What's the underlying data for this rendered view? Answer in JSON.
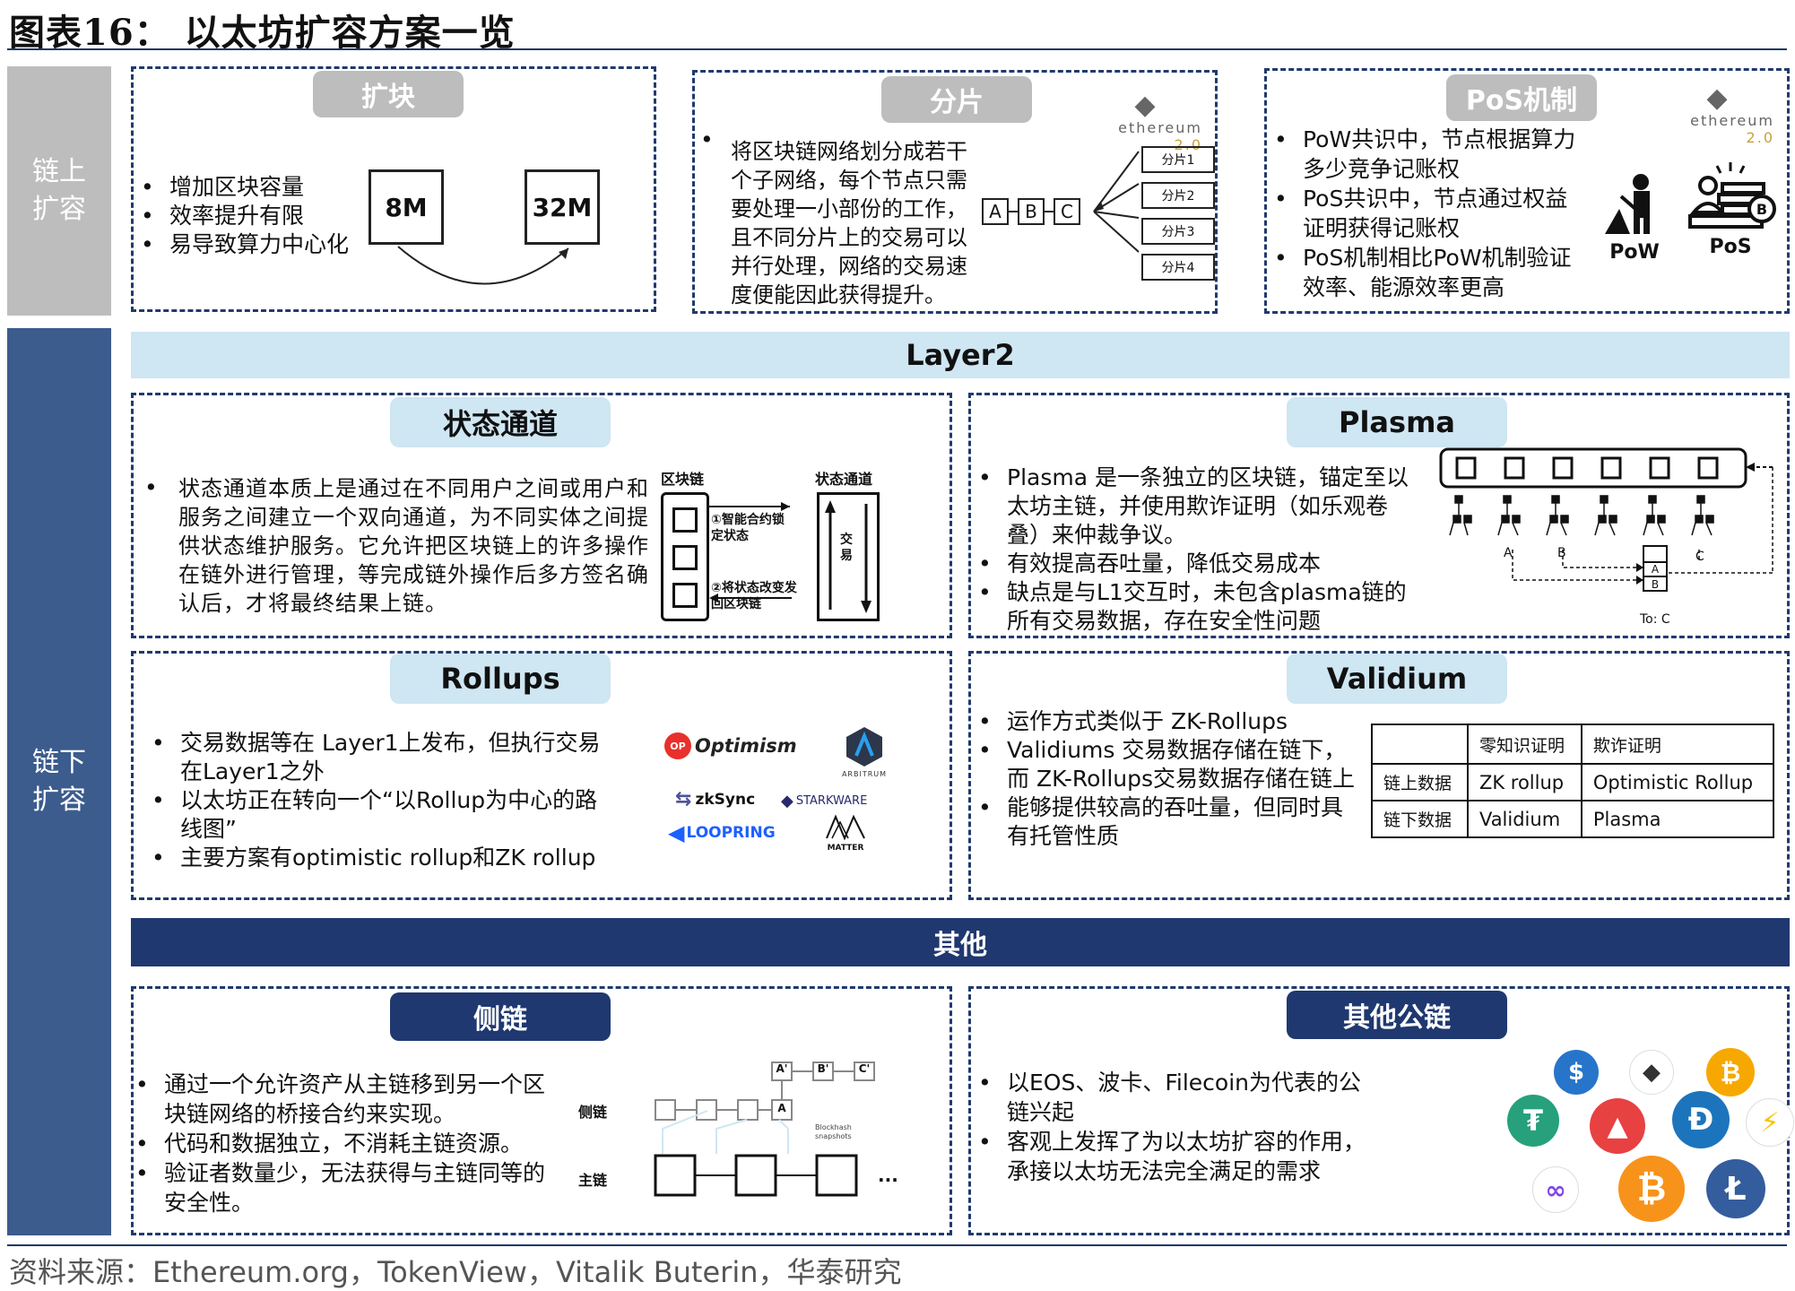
{
  "header": {
    "title": "图表16：  以太坊扩容方案一览"
  },
  "footer": {
    "source": "资料来源：Ethereum.org，TokenView，Vitalik Buterin，华泰研究"
  },
  "sides": {
    "onchain": "链上\n扩容",
    "offchain": "链下\n扩容"
  },
  "bars": {
    "layer2": "Layer2",
    "others": "其他"
  },
  "expand": {
    "title": "扩块",
    "bullets": [
      "增加区块容量",
      "效率提升有限",
      "易导致算力中心化"
    ],
    "box_a": "8M",
    "box_b": "32M"
  },
  "shard": {
    "title": "分片",
    "text_lines": [
      "将区块链网络划分成若干",
      "个子网络，每个节点只需",
      "要处理一小部份的工作，",
      "且不同分片上的交易可以",
      "并行处理，网络的交易速",
      "度便能因此获得提升。"
    ],
    "chain": [
      "A",
      "B",
      "C"
    ],
    "shards": [
      "分片1",
      "分片2",
      "分片3",
      "分片4"
    ],
    "eth_logo": "ethereum",
    "eth_ver": "2.0"
  },
  "pos": {
    "title": "PoS机制",
    "bullets": [
      "PoW共识中，节点根据算力多少竞争记账权",
      "PoS共识中，节点通过权益证明获得记账权",
      "PoS机制相比PoW机制验证效率、能源效率更高"
    ],
    "pow_label": "PoW",
    "pos_label": "PoS",
    "eth_logo": "ethereum",
    "eth_ver": "2.0"
  },
  "state_channel": {
    "title": "状态通道",
    "text": "状态通道本质上是通过在不同用户之间或用户和服务之间建立一个双向通道，为不同实体之间提供状态维护服务。它允许把区块链上的许多操作在链外进行管理，等完成链外操作后多方签名确认后，才将最终结果上链。",
    "label_chain": "区块链",
    "label_channel": "状态通道",
    "step1": "①智能合约锁定状态",
    "step2": "②将状态改变发回区块链",
    "trade": "交易"
  },
  "plasma": {
    "title": "Plasma",
    "bullets": [
      "Plasma 是一条独立的区块链，锚定至以太坊主链，并使用欺诈证明（如乐观卷叠）来仲裁争议。",
      "有效提高吞吐量，降低交易成本",
      "缺点是与L1交互时，未包含plasma链的所有交易数据，存在安全性问题"
    ],
    "labels": [
      "A",
      "B",
      "C"
    ],
    "stack": [
      "A",
      "B"
    ],
    "to": "To: C"
  },
  "rollups": {
    "title": "Rollups",
    "bullets": [
      "交易数据等在 Layer1上发布，但执行交易在Layer1之外",
      "以太坊正在转向一个“以Rollup为中心的路线图”",
      "主要方案有optimistic rollup和ZK rollup"
    ],
    "logos": [
      "Optimism",
      "ARBITRUM",
      "zkSync",
      "STARKWARE",
      "LOOPRING",
      "MATTER"
    ]
  },
  "validium": {
    "title": "Validium",
    "bullets": [
      "运作方式类似于 ZK-Rollups",
      "Validiums 交易数据存储在链下，而 ZK-Rollups交易数据存储在链上",
      "能够提供较高的吞吐量，但同时具有托管性质"
    ],
    "table": {
      "head": [
        "",
        "零知识证明",
        "欺诈证明"
      ],
      "rows": [
        [
          "链上数据",
          "ZK rollup",
          "Optimistic Rollup"
        ],
        [
          "链下数据",
          "Validium",
          "Plasma"
        ]
      ]
    }
  },
  "sidechain": {
    "title": "侧链",
    "bullets": [
      "通过一个允许资产从主链移到另一个区块链网络的桥接合约来实现。",
      "代码和数据独立，不消耗主链资源。",
      "验证者数量少，无法获得与主链同等的安全性。"
    ],
    "label_side": "侧链",
    "label_main": "主链",
    "side_blocks": [
      "A'",
      "B'",
      "C'",
      "A"
    ],
    "snapshot": "Blockhash snapshots",
    "more": "..."
  },
  "other_chains": {
    "title": "其他公链",
    "bullets": [
      "以EOS、波卡、Filecoin为代表的公链兴起",
      "客观上发挥了为以太坊扩容的作用，承接以太坊无法完全满足的需求"
    ],
    "coins": [
      {
        "name": "usdc-icon",
        "color": "#2775ca",
        "glyph": "$"
      },
      {
        "name": "ethereum-icon",
        "color": "#ffffff",
        "glyph": "◆"
      },
      {
        "name": "bat-icon",
        "color": "#f7a800",
        "glyph": "₿"
      },
      {
        "name": "tether-icon",
        "color": "#26a17b",
        "glyph": "₮"
      },
      {
        "name": "avalanche-icon",
        "color": "#e84142",
        "glyph": "▲"
      },
      {
        "name": "dash-icon",
        "color": "#1c75bc",
        "glyph": "Đ"
      },
      {
        "name": "bolt-icon",
        "color": "#ffffff",
        "glyph": "⚡"
      },
      {
        "name": "polygon-icon",
        "color": "#ffffff",
        "glyph": "∞"
      },
      {
        "name": "bitcoin-icon",
        "color": "#f7931a",
        "glyph": "₿"
      },
      {
        "name": "litecoin-icon",
        "color": "#345d9d",
        "glyph": "Ł"
      }
    ]
  },
  "colors": {
    "navy": "#1f3870",
    "side_gray": "#bdbdbd",
    "light_blue": "#cfe6f3",
    "side_blue": "#3b5c8d"
  }
}
